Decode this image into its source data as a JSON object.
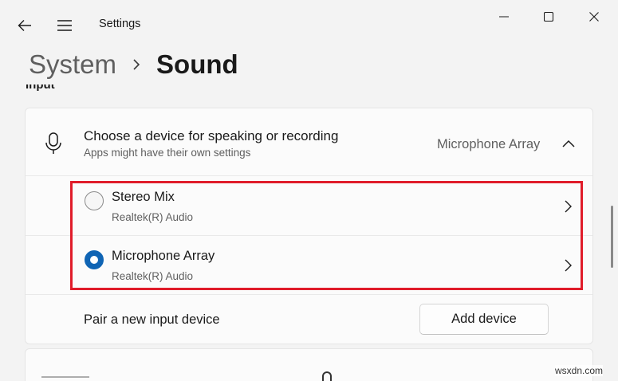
{
  "titlebar": {
    "app_title": "Settings"
  },
  "breadcrumb": {
    "parent": "System",
    "current": "Sound"
  },
  "section": {
    "label": "Input"
  },
  "input_card": {
    "header_title": "Choose a device for speaking or recording",
    "header_subtitle": "Apps might have their own settings",
    "selected_device": "Microphone Array",
    "devices": [
      {
        "name": "Stereo Mix",
        "driver": "Realtek(R) Audio",
        "selected": false
      },
      {
        "name": "Microphone Array",
        "driver": "Realtek(R) Audio",
        "selected": true
      }
    ],
    "pair_label": "Pair a new input device",
    "add_button": "Add device"
  },
  "colors": {
    "accent": "#0f64b4",
    "highlight": "#e01c2a",
    "background": "#f3f3f3"
  },
  "watermark": "wsxdn.com"
}
